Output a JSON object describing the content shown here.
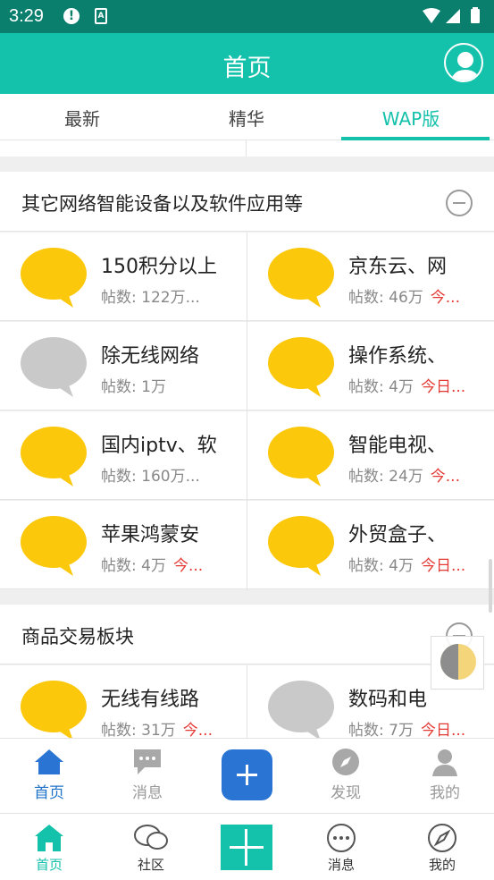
{
  "status_bar": {
    "time": "3:29",
    "alert_glyph": "!",
    "app_glyph": "A"
  },
  "header": {
    "title": "首页"
  },
  "tabs": [
    {
      "label": "最新"
    },
    {
      "label": "精华"
    },
    {
      "label": "WAP版",
      "active": true
    }
  ],
  "sections": [
    {
      "title": "其它网络智能设备以及软件应用等",
      "forums": [
        {
          "name": "150积分以上",
          "posts": "帖数: 122万...",
          "today": "",
          "icon": "yellow"
        },
        {
          "name": "京东云、网",
          "posts": "帖数: 46万",
          "today": "今...",
          "icon": "yellow"
        },
        {
          "name": "除无线网络",
          "posts": "帖数: 1万",
          "today": "",
          "icon": "gray"
        },
        {
          "name": "操作系统、",
          "posts": "帖数: 4万",
          "today": "今日...",
          "icon": "yellow"
        },
        {
          "name": "国内iptv、软",
          "posts": "帖数: 160万...",
          "today": "",
          "icon": "yellow"
        },
        {
          "name": "智能电视、",
          "posts": "帖数: 24万",
          "today": "今...",
          "icon": "yellow"
        },
        {
          "name": "苹果鸿蒙安",
          "posts": "帖数: 4万",
          "today": "今...",
          "icon": "yellow"
        },
        {
          "name": "外贸盒子、",
          "posts": "帖数: 4万",
          "today": "今日...",
          "icon": "yellow"
        }
      ]
    },
    {
      "title": "商品交易板块",
      "forums": [
        {
          "name": "无线有线路",
          "posts": "帖数: 31万",
          "today": "今...",
          "icon": "yellow"
        },
        {
          "name": "数码和电",
          "posts": "帖数: 7万",
          "today": "今日...",
          "icon": "gray"
        }
      ]
    }
  ],
  "nav_primary": [
    {
      "label": "首页",
      "icon": "home-icon",
      "active": true
    },
    {
      "label": "消息",
      "icon": "message-icon"
    },
    {
      "label": "",
      "icon": "plus-icon"
    },
    {
      "label": "发现",
      "icon": "compass-icon"
    },
    {
      "label": "我的",
      "icon": "user-icon"
    }
  ],
  "nav_secondary": [
    {
      "label": "首页",
      "icon": "home-icon",
      "active": true
    },
    {
      "label": "社区",
      "icon": "chat-bubbles-icon"
    },
    {
      "label": "",
      "icon": "plus-icon"
    },
    {
      "label": "消息",
      "icon": "message-dots-icon"
    },
    {
      "label": "我的",
      "icon": "compass-icon"
    }
  ],
  "colors": {
    "teal": "#14c1aa",
    "status_bar": "#0a7f6e",
    "blue_accent": "#2a74d3",
    "bubble_yellow": "#fcc80c",
    "bubble_gray": "#c9c9c9",
    "today_red": "#e53935"
  }
}
